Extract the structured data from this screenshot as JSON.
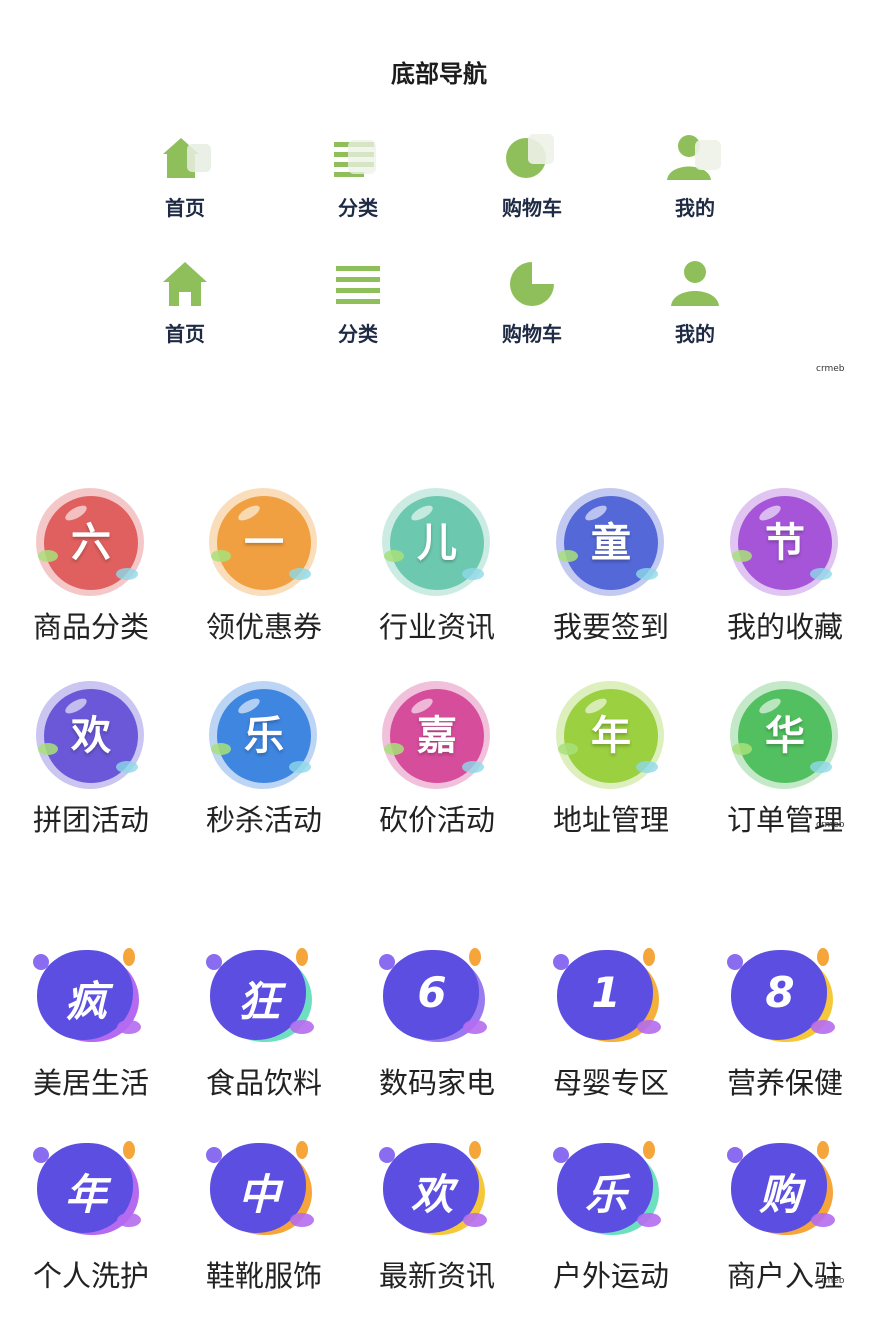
{
  "title": "底部导航",
  "nav_rows": [
    {
      "style": "blurred",
      "items": [
        {
          "label": "首页",
          "icon": "home-icon"
        },
        {
          "label": "分类",
          "icon": "list-icon"
        },
        {
          "label": "购物车",
          "icon": "cart-pie-icon"
        },
        {
          "label": "我的",
          "icon": "user-icon"
        }
      ]
    },
    {
      "style": "flat",
      "items": [
        {
          "label": "首页",
          "icon": "home-icon"
        },
        {
          "label": "分类",
          "icon": "list-icon"
        },
        {
          "label": "购物车",
          "icon": "cart-pie-icon"
        },
        {
          "label": "我的",
          "icon": "user-icon"
        }
      ]
    }
  ],
  "nav_color": "#8fbf5a",
  "watermark": "crmeb",
  "bubble_grid": [
    {
      "char": "六",
      "label": "商品分类",
      "color": "#e06060"
    },
    {
      "char": "一",
      "label": "领优惠券",
      "color": "#f0a040"
    },
    {
      "char": "儿",
      "label": "行业资讯",
      "color": "#6cc9b0"
    },
    {
      "char": "童",
      "label": "我要签到",
      "color": "#5468d8"
    },
    {
      "char": "节",
      "label": "我的收藏",
      "color": "#a655d8"
    },
    {
      "char": "欢",
      "label": "拼团活动",
      "color": "#6a58d8"
    },
    {
      "char": "乐",
      "label": "秒杀活动",
      "color": "#3f86e0"
    },
    {
      "char": "嘉",
      "label": "砍价活动",
      "color": "#d64d9c"
    },
    {
      "char": "年",
      "label": "地址管理",
      "color": "#9bd040"
    },
    {
      "char": "华",
      "label": "订单管理",
      "color": "#52c060"
    }
  ],
  "blob_grid": [
    {
      "char": "疯",
      "label": "美居生活",
      "accent": "#b56bf0"
    },
    {
      "char": "狂",
      "label": "食品饮料",
      "accent": "#6ee0c0"
    },
    {
      "char": "6",
      "label": "数码家电",
      "accent": "#9a7af0"
    },
    {
      "char": "1",
      "label": "母婴专区",
      "accent": "#f5b03a"
    },
    {
      "char": "8",
      "label": "营养保健",
      "accent": "#f5c83a"
    },
    {
      "char": "年",
      "label": "个人洗护",
      "accent": "#b56bf0"
    },
    {
      "char": "中",
      "label": "鞋靴服饰",
      "accent": "#f5a53a"
    },
    {
      "char": "欢",
      "label": "最新资讯",
      "accent": "#f5c83a"
    },
    {
      "char": "乐",
      "label": "户外运动",
      "accent": "#6ee0c0"
    },
    {
      "char": "购",
      "label": "商户入驻",
      "accent": "#f5a53a"
    }
  ]
}
